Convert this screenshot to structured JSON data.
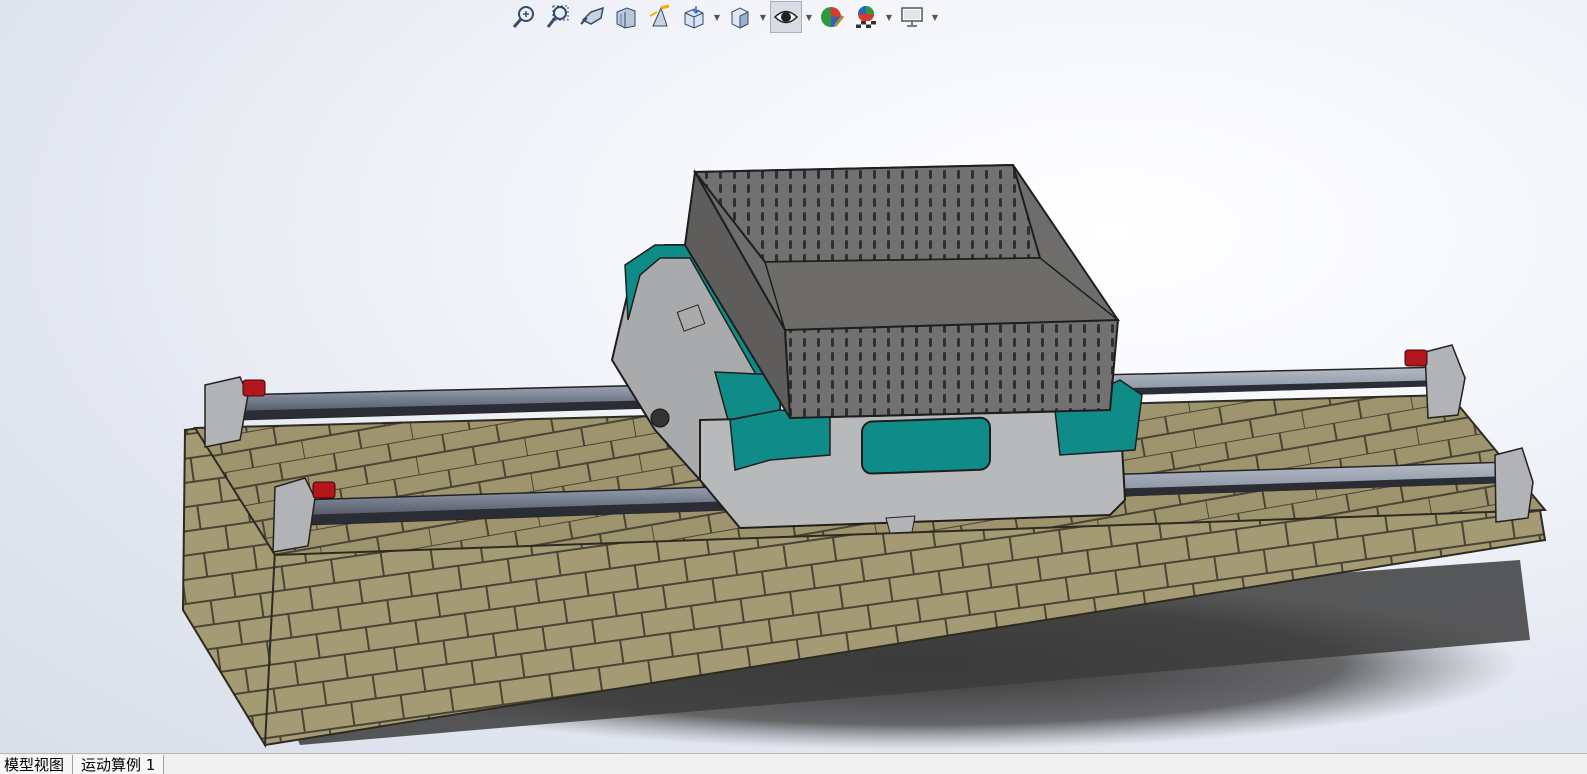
{
  "toolbar": {
    "items": [
      {
        "icon": "zoom-to-fit-icon"
      },
      {
        "icon": "zoom-to-area-icon"
      },
      {
        "icon": "previous-view-icon"
      },
      {
        "icon": "section-view-icon"
      },
      {
        "icon": "dynamic-annotation-view-icon"
      },
      {
        "icon": "view-orientation-icon"
      },
      {
        "icon": "display-style-icon"
      },
      {
        "icon": "hide-show-items-icon",
        "active": true
      },
      {
        "icon": "edit-appearance-icon"
      },
      {
        "icon": "apply-scene-icon"
      },
      {
        "icon": "view-settings-icon"
      }
    ]
  },
  "tabs": {
    "model_label": "模型视图",
    "motion_label": "运动算例 1"
  },
  "colors": {
    "teal": "#0f8c87",
    "housing_gray": "#a9aaab",
    "brick": "#a49a74",
    "rail": "#8d96a6",
    "stopper_red": "#b3161c",
    "toolbar_active": "#d9dde3"
  }
}
